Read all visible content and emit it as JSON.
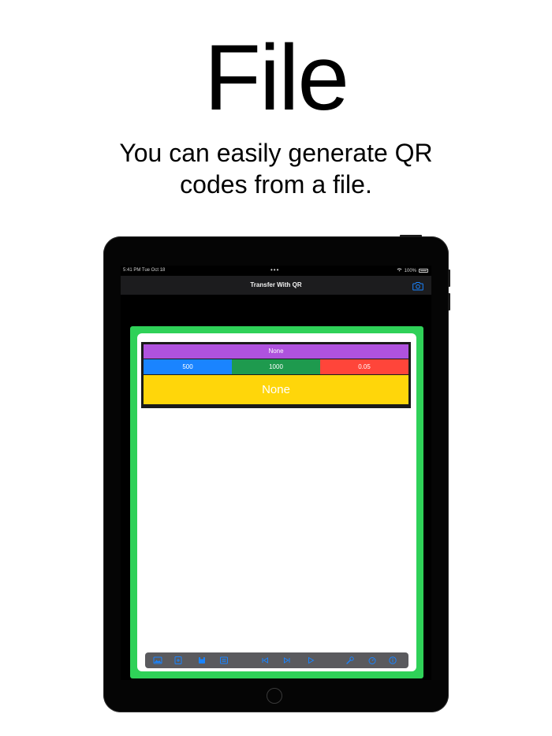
{
  "promo": {
    "headline": "File",
    "subline_line1": "You can easily generate QR",
    "subline_line2": "codes from a file."
  },
  "status_bar": {
    "time": "5:41 PM  Tue Oct 18",
    "dots": "•••",
    "battery": "100%"
  },
  "nav_bar": {
    "title": "Transfer With QR",
    "camera_icon": "camera-icon"
  },
  "panel": {
    "file_name": "None",
    "params": [
      "500",
      "1000",
      "0.05"
    ],
    "status": "None"
  },
  "toolbar": {
    "icons": [
      "image-icon",
      "add-file-icon",
      "save-icon",
      "list-icon",
      "skip-back-icon",
      "skip-forward-icon",
      "play-icon",
      "wrench-icon",
      "timer-icon",
      "info-icon"
    ]
  },
  "colors": {
    "frame": "#2fd158",
    "name_row": "#af52de",
    "param_1": "#1a84ff",
    "param_2": "#1e9a4e",
    "param_3": "#ff453a",
    "status_row": "#ffd60a",
    "accent": "#1a84ff"
  }
}
